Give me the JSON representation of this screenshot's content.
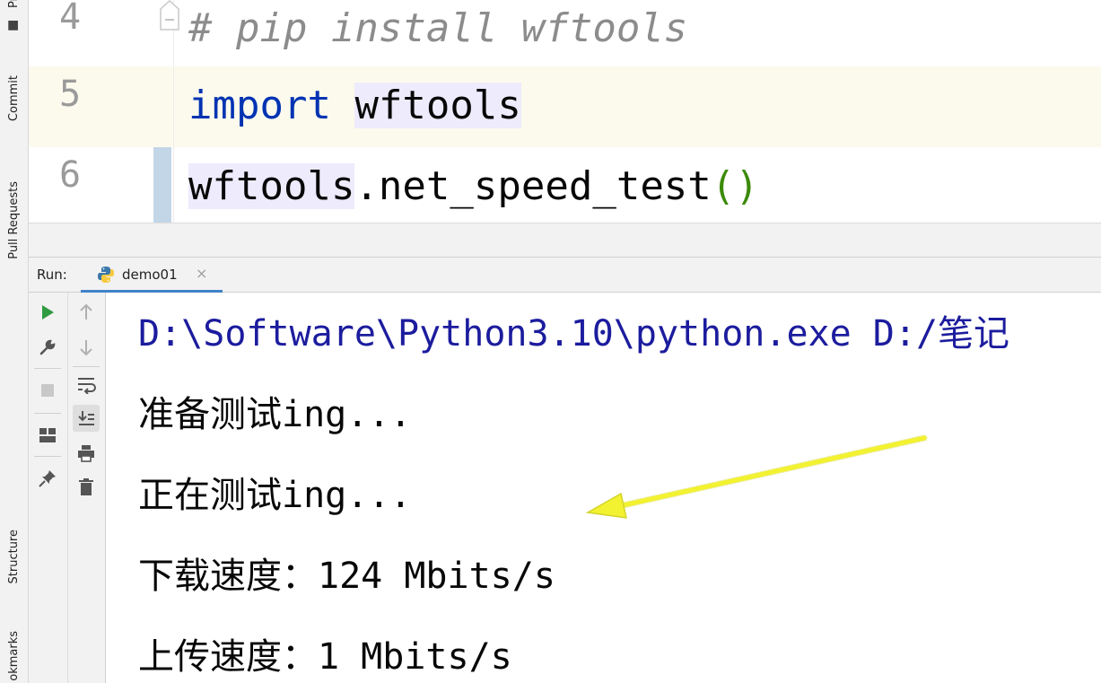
{
  "sidebar": {
    "tabs": [
      {
        "label": "Pr"
      },
      {
        "label": "Commit"
      },
      {
        "label": "Pull Requests"
      },
      {
        "label": "Structure"
      },
      {
        "label": "okmarks"
      }
    ]
  },
  "editor": {
    "lines": [
      {
        "number": "4",
        "comment": "# pip install wftools"
      },
      {
        "number": "5",
        "keyword": "import",
        "module": "wftools"
      },
      {
        "number": "6",
        "object": "wftools",
        "call": ".net_speed_test",
        "open_paren": "(",
        "close_paren": ")"
      }
    ]
  },
  "run_panel": {
    "label": "Run:",
    "tab_label": "demo01",
    "close_glyph": "×"
  },
  "console": {
    "lines": [
      "D:\\Software\\Python3.10\\python.exe D:/笔记",
      "准备测试ing...",
      "正在测试ing...",
      "下载速度：124 Mbits/s",
      "上传速度：1 Mbits/s"
    ]
  },
  "colors": {
    "keyword": "#0033b3",
    "comment": "#8c8c8c",
    "command_text": "#1c1c9e",
    "annotation_arrow": "#f2f230",
    "run_icon": "#2f9a41"
  },
  "icons": [
    "project-icon",
    "commit-icon",
    "pull-requests-icon",
    "structure-icon",
    "python-icon",
    "run-icon",
    "wrench-icon",
    "stop-icon",
    "layout-icon",
    "pin-icon",
    "up-arrow-icon",
    "down-arrow-icon",
    "soft-wrap-icon",
    "scroll-to-end-icon",
    "print-icon",
    "trash-icon"
  ]
}
